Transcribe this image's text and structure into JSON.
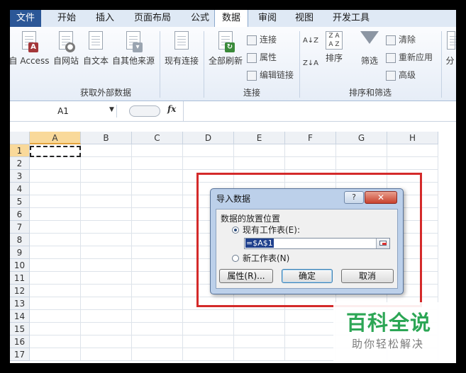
{
  "tabs": [
    "文件",
    "开始",
    "插入",
    "页面布局",
    "公式",
    "数据",
    "审阅",
    "视图",
    "开发工具"
  ],
  "active_tab": "数据",
  "ribbon": {
    "get_external": {
      "buttons": [
        {
          "label": "自 Access",
          "overlay": "A",
          "overlay_color": "#a4373a"
        },
        {
          "label": "自网站",
          "overlay": "●",
          "overlay_color": "#7a7a7a"
        },
        {
          "label": "自文本",
          "overlay": "",
          "overlay_color": "#ffffff"
        },
        {
          "label": "自其他来源",
          "overlay": "▾",
          "overlay_color": "#9aa4b0"
        },
        {
          "label": "现有连接",
          "overlay": "",
          "overlay_color": "#ffffff"
        }
      ],
      "group_label": "获取外部数据"
    },
    "connections": {
      "refresh_label": "全部刷新",
      "items": [
        "连接",
        "属性",
        "编辑链接"
      ],
      "group_label": "连接"
    },
    "sort_filter": {
      "sort_asc": "A↓Z",
      "sort_desc": "Z↓A",
      "sort_label": "排序",
      "filter_label": "筛选",
      "items": [
        "清除",
        "重新应用",
        "高级"
      ],
      "group_label": "排序和筛选"
    },
    "cut_label": "分"
  },
  "formula_bar": {
    "name_box": "A1",
    "fx": "fx",
    "formula": ""
  },
  "grid": {
    "columns": [
      "A",
      "B",
      "C",
      "D",
      "E",
      "F",
      "G",
      "H"
    ],
    "rows": [
      "1",
      "2",
      "3",
      "4",
      "5",
      "6",
      "7",
      "8",
      "9",
      "10",
      "11",
      "12",
      "13",
      "14",
      "15",
      "16",
      "17"
    ],
    "selected_cell": "A1"
  },
  "dialog": {
    "title": "导入数据",
    "help": "?",
    "close": "✕",
    "section_label": "数据的放置位置",
    "option_existing": "现有工作表(E):",
    "option_new": "新工作表(N)",
    "reference_value": "=$A$1",
    "btn_properties": "属性(R)...",
    "btn_ok": "确定",
    "btn_cancel": "取消"
  },
  "watermark": {
    "main": "百科全说",
    "sub": "助你轻松解决"
  },
  "colors": {
    "file_tab": "#2b5797",
    "highlight_box": "#d42a2a",
    "watermark": "#2ca655"
  }
}
